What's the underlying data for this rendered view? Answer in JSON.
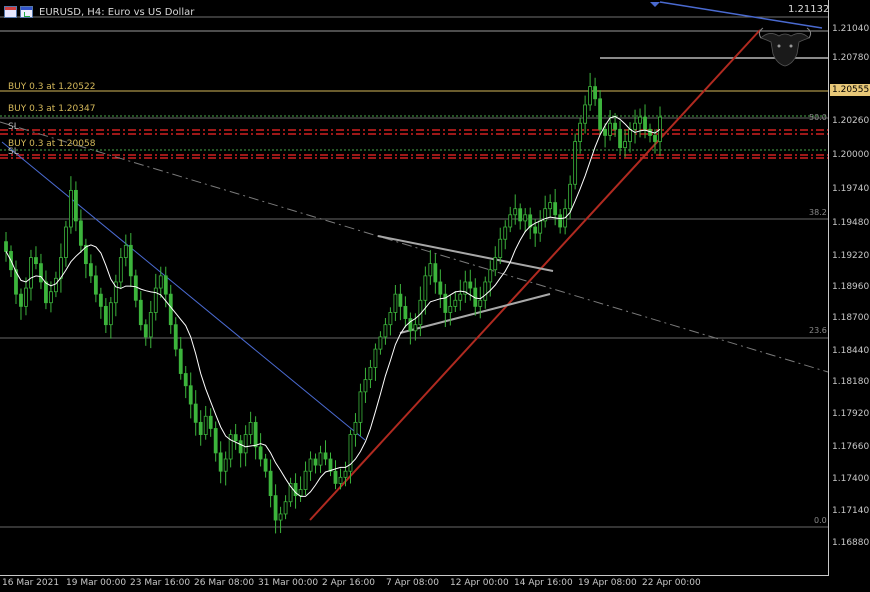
{
  "window": {
    "title": "EURUSD, H4:  Euro vs US Dollar",
    "top_price_label": "1.21132"
  },
  "price_axis": {
    "labels": [
      "1.21040",
      "1.20780",
      "1.20555",
      "1.20260",
      "1.20000",
      "1.19740",
      "1.19480",
      "1.19220",
      "1.18960",
      "1.18700",
      "1.18440",
      "1.18180",
      "1.17920",
      "1.17660",
      "1.17400",
      "1.17140",
      "1.16880"
    ],
    "current_price": "1.20555"
  },
  "time_axis": {
    "labels": [
      "16 Mar 2021",
      "19 Mar 00:00",
      "23 Mar 16:00",
      "26 Mar 08:00",
      "31 Mar 00:00",
      "2 Apr 16:00",
      "7 Apr 08:00",
      "12 Apr 00:00",
      "14 Apr 16:00",
      "19 Apr 08:00",
      "22 Apr 00:00"
    ]
  },
  "orders": [
    {
      "label": "BUY 0.3 at 1.20522"
    },
    {
      "label": "BUY 0.3 at 1.20347"
    },
    {
      "label": "BUY 0.3 at 1.20058"
    },
    {
      "label": "SL"
    },
    {
      "label": "SL"
    }
  ],
  "fibonacci": [
    {
      "label": "50.0"
    },
    {
      "label": "38.2"
    },
    {
      "label": "23.6"
    },
    {
      "label": "0.0"
    }
  ],
  "colors": {
    "background": "#000000",
    "bull_candle": "#3cb43c",
    "bear_candle": "#3cb43c",
    "moving_average": "#ffffff",
    "trend_down": "#4a6ad0",
    "trend_up": "#b02a20",
    "order_line": "#d4b85a",
    "stop_line": "#d02020",
    "fib_line": "#8a8a8a",
    "triangle": "#a8a8a8",
    "current_price_tag": "#e8c878"
  },
  "chart_data": {
    "type": "candlestick",
    "symbol": "EURUSD",
    "timeframe": "H4",
    "ylim": [
      1.1675,
      1.2132
    ],
    "closes": [
      1.194,
      1.1925,
      1.1905,
      1.1895,
      1.191,
      1.1935,
      1.193,
      1.1915,
      1.1898,
      1.1907,
      1.1918,
      1.1935,
      1.196,
      1.199,
      1.1965,
      1.1945,
      1.193,
      1.192,
      1.1905,
      1.1895,
      1.188,
      1.1898,
      1.1915,
      1.1935,
      1.1945,
      1.192,
      1.19,
      1.188,
      1.187,
      1.189,
      1.191,
      1.192,
      1.1905,
      1.188,
      1.186,
      1.184,
      1.183,
      1.1815,
      1.18,
      1.179,
      1.1805,
      1.1795,
      1.1775,
      1.176,
      1.177,
      1.179,
      1.1785,
      1.1775,
      1.179,
      1.18,
      1.178,
      1.177,
      1.176,
      1.174,
      1.172,
      1.1725,
      1.1735,
      1.175,
      1.174,
      1.1745,
      1.176,
      1.177,
      1.1765,
      1.1775,
      1.177,
      1.176,
      1.175,
      1.1755,
      1.176,
      1.179,
      1.18,
      1.1825,
      1.1835,
      1.1845,
      1.186,
      1.187,
      1.188,
      1.189,
      1.1905,
      1.1895,
      1.1885,
      1.1875,
      1.188,
      1.19,
      1.192,
      1.193,
      1.1915,
      1.1905,
      1.189,
      1.1895,
      1.19,
      1.1905,
      1.1915,
      1.191,
      1.1895,
      1.19,
      1.1915,
      1.1925,
      1.1935,
      1.195,
      1.196,
      1.197,
      1.1975,
      1.1965,
      1.197,
      1.196,
      1.1955,
      1.1965,
      1.1975,
      1.198,
      1.197,
      1.196,
      1.1975,
      1.1995,
      1.203,
      1.2045,
      1.206,
      1.2075,
      1.2065,
      1.204,
      1.2035,
      1.2045,
      1.204,
      1.2025,
      1.203,
      1.204,
      1.2045,
      1.205,
      1.204,
      1.2035,
      1.203,
      1.205
    ]
  }
}
